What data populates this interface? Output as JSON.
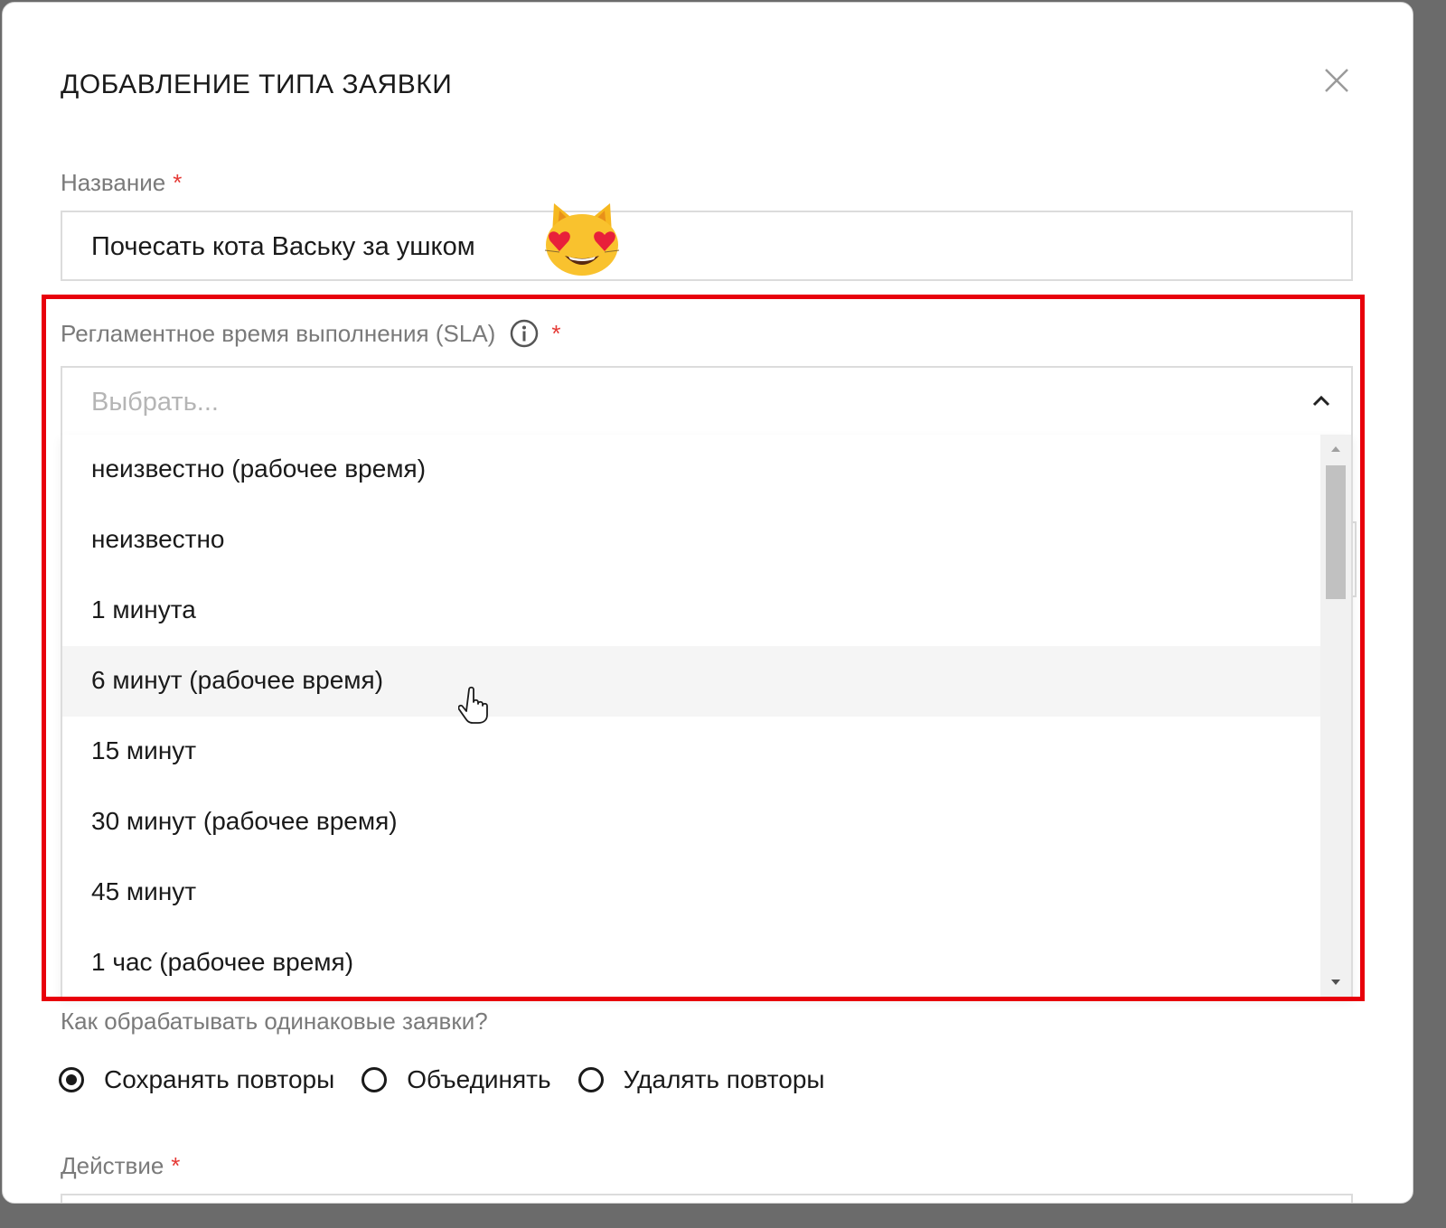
{
  "dialog": {
    "title": "ДОБАВЛЕНИЕ ТИПА ЗАЯВКИ",
    "close_icon": "close-icon"
  },
  "name_field": {
    "label": "Название",
    "required_mark": "*",
    "value": "Почесать кота Ваську за ушком",
    "emoji": "smiling-cat-with-heart-eyes"
  },
  "sla_field": {
    "label": "Регламентное время выполнения (SLA)",
    "info_icon": "info-icon",
    "required_mark": "*",
    "placeholder": "Выбрать...",
    "expanded": true,
    "options": [
      {
        "label": "неизвестно (рабочее время)"
      },
      {
        "label": "неизвестно"
      },
      {
        "label": "1 минута"
      },
      {
        "label": "6 минут (рабочее время)",
        "hovered": true
      },
      {
        "label": "15 минут"
      },
      {
        "label": "30 минут (рабочее время)"
      },
      {
        "label": "45 минут"
      },
      {
        "label": "1 час (рабочее время)"
      }
    ]
  },
  "duplicates": {
    "label": "Как обрабатывать одинаковые заявки?",
    "options": [
      {
        "label": "Сохранять повторы",
        "checked": true
      },
      {
        "label": "Объединять",
        "checked": false
      },
      {
        "label": "Удалять повторы",
        "checked": false
      }
    ]
  },
  "action_field": {
    "label": "Действие",
    "required_mark": "*"
  },
  "colors": {
    "highlight": "#e8000b",
    "required": "#e53935",
    "label": "#7a7a7a"
  }
}
